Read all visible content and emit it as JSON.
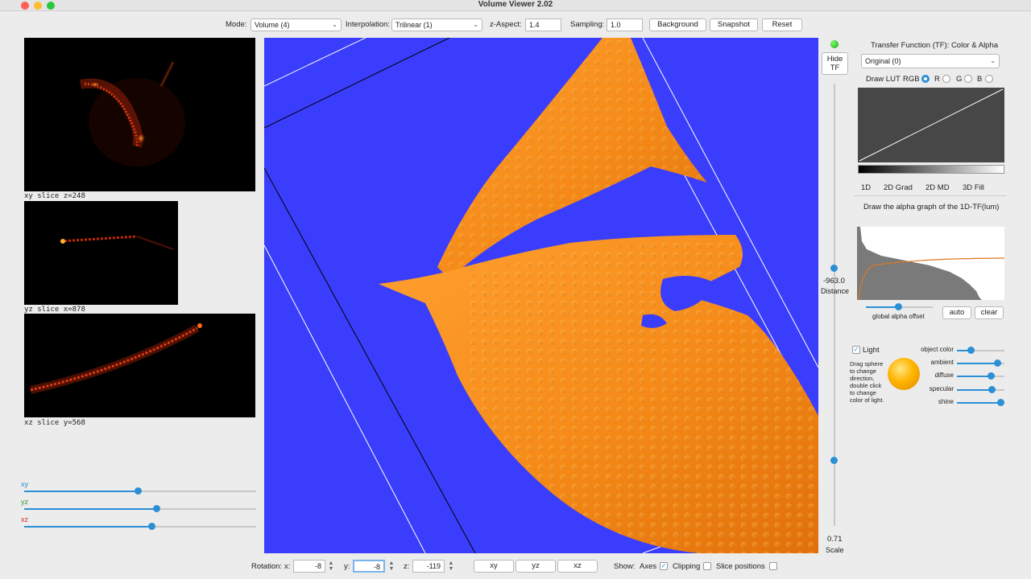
{
  "window": {
    "title": "Volume Viewer 2.02"
  },
  "toolbar": {
    "mode_label": "Mode:",
    "mode_value": "Volume (4)",
    "interp_label": "Interpolation:",
    "interp_value": "Trilinear (1)",
    "zaspect_label": "z-Aspect:",
    "zaspect_value": "1.4",
    "sampling_label": "Sampling:",
    "sampling_value": "1.0",
    "background_btn": "Background",
    "snapshot_btn": "Snapshot",
    "reset_btn": "Reset"
  },
  "slices": {
    "xy_label": "xy slice  z=248",
    "yz_label": "yz slice  x=878",
    "xz_label": "xz slice  y=568"
  },
  "slice_sliders": [
    {
      "name": "xy",
      "color": "#2b8fd6",
      "value": 0.49
    },
    {
      "name": "yz",
      "color": "#3a9a3a",
      "value": 0.57
    },
    {
      "name": "xz",
      "color": "#d03030",
      "value": 0.55
    }
  ],
  "view": {
    "background_color": "#3a3dfb",
    "volume_color": "#f7931e"
  },
  "right_controls": {
    "hide_tf_line1": "Hide",
    "hide_tf_line2": "TF",
    "distance_value": "-963.0",
    "distance_label": "Distance",
    "scale_value": "0.71",
    "scale_label": "Scale",
    "distance_fraction": 0.5,
    "scale_fraction": 0.15
  },
  "tf": {
    "title": "Transfer Function (TF): Color & Alpha",
    "lut_select": "Original (0)",
    "draw_lut_label": "Draw LUT",
    "rgb_label": "RGB",
    "r_label": "R",
    "g_label": "G",
    "b_label": "B",
    "tabs": [
      "1D",
      "2D Grad",
      "2D MD",
      "3D Fill"
    ],
    "active_tab": "1D",
    "instruction": "Draw the alpha graph of the 1D-TF(lum)",
    "global_alpha_label": "global alpha offset",
    "auto_btn": "auto",
    "clear_btn": "clear"
  },
  "light": {
    "checkbox_label": "Light",
    "enabled": true,
    "help_text": [
      "Drag sphere",
      "to change",
      "direction,",
      "double click",
      "to change",
      "color of light."
    ],
    "sliders": [
      {
        "label": "object color",
        "value": 0.28
      },
      {
        "label": "ambient",
        "value": 0.85
      },
      {
        "label": "diffuse",
        "value": 0.72
      },
      {
        "label": "specular",
        "value": 0.73
      },
      {
        "label": "shine",
        "value": 0.92
      }
    ]
  },
  "bottom": {
    "rotation_label": "Rotation:",
    "x_label": "x:",
    "x_value": "-8",
    "y_label": "y:",
    "y_value": "-8",
    "z_label": "z:",
    "z_value": "-119",
    "view_xy": "xy",
    "view_yz": "yz",
    "view_xz": "xz",
    "show_label": "Show:",
    "axes_label": "Axes",
    "axes_checked": true,
    "clipping_label": "Clipping",
    "slice_positions_label": "Slice positions"
  }
}
